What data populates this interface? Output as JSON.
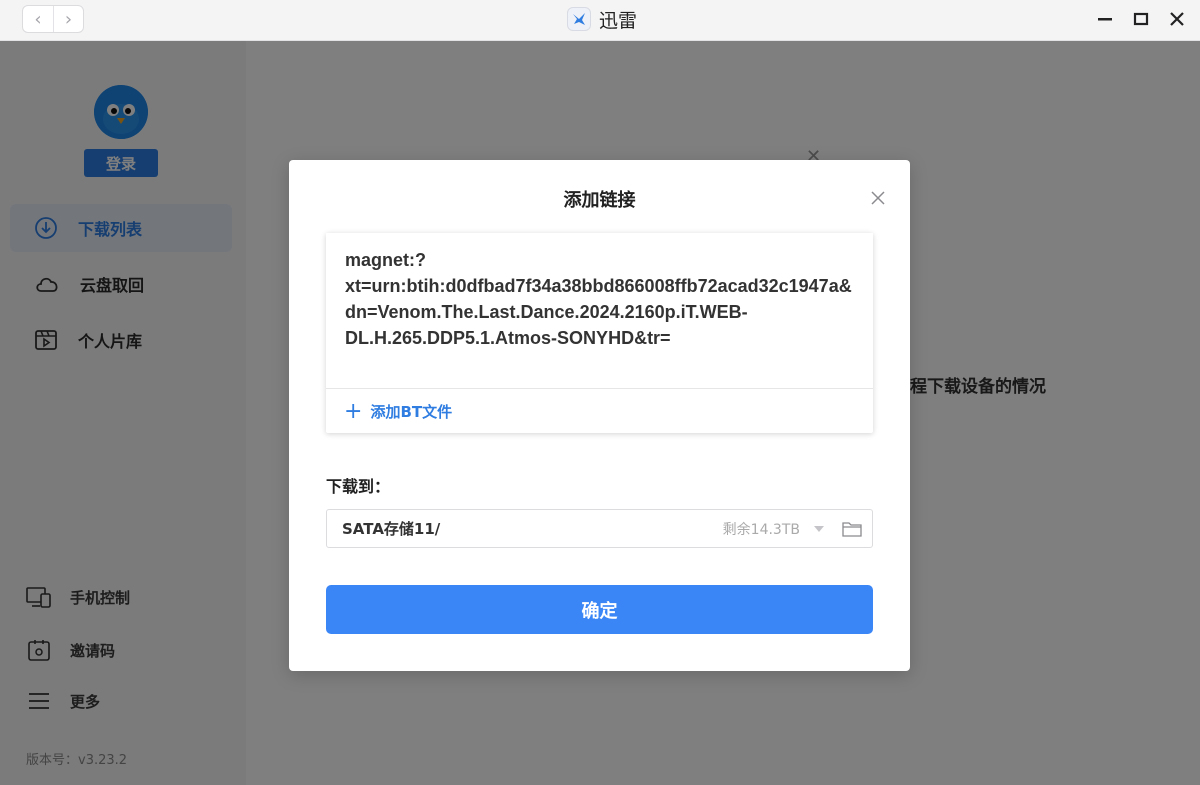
{
  "window": {
    "app_name": "迅雷"
  },
  "sidebar": {
    "login_label": "登录",
    "items": [
      {
        "label": "下载列表",
        "icon": "download-icon",
        "active": true
      },
      {
        "label": "云盘取回",
        "icon": "cloud-icon",
        "active": false
      },
      {
        "label": "个人片库",
        "icon": "video-library-icon",
        "active": false
      }
    ],
    "bottom_items": [
      {
        "label": "手机控制",
        "icon": "phone-control-icon"
      },
      {
        "label": "邀请码",
        "icon": "invite-code-icon"
      },
      {
        "label": "更多",
        "icon": "menu-icon"
      }
    ],
    "version": "版本号：v3.23.2"
  },
  "background": {
    "partial_text": "程下载设备的情况"
  },
  "dialog": {
    "title": "添加链接",
    "link_value": "magnet:?xt=urn:btih:d0dfbad7f34a38bbd866008ffb72acad32c1947a&dn=Venom.The.Last.Dance.2024.2160p.iT.WEB-DL.H.265.DDP5.1.Atmos-SONYHD&tr=",
    "add_bt_label": "添加BT文件",
    "download_to_label": "下载到：",
    "path": {
      "value": "SATA存储11/",
      "free_space": "剩余14.3TB"
    },
    "confirm_label": "确定"
  },
  "colors": {
    "accent": "#3b86f7",
    "link_blue": "#2f7de1",
    "overlay": "rgba(0,0,0,0.5)"
  }
}
